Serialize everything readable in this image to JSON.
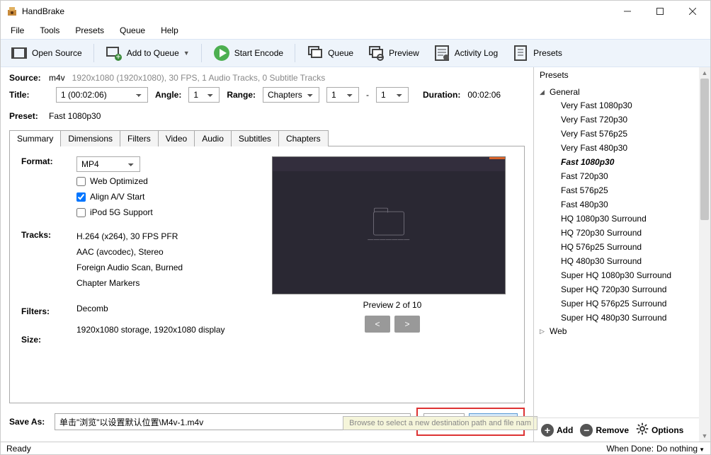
{
  "window": {
    "title": "HandBrake"
  },
  "menubar": [
    "File",
    "Tools",
    "Presets",
    "Queue",
    "Help"
  ],
  "toolbar": [
    {
      "id": "open-source",
      "label": "Open Source"
    },
    {
      "id": "add-queue",
      "label": "Add to Queue",
      "dropdown": true
    },
    {
      "id": "start-encode",
      "label": "Start Encode"
    },
    {
      "id": "queue",
      "label": "Queue"
    },
    {
      "id": "preview",
      "label": "Preview"
    },
    {
      "id": "activity-log",
      "label": "Activity Log"
    },
    {
      "id": "presets",
      "label": "Presets"
    }
  ],
  "labels": {
    "source": "Source:",
    "title": "Title:",
    "angle": "Angle:",
    "range": "Range:",
    "duration": "Duration:",
    "preset": "Preset:",
    "format": "Format:",
    "tracks": "Tracks:",
    "filters": "Filters:",
    "size": "Size:",
    "save_as": "Save As:",
    "browse": "Browse",
    "presets_hdr": "Presets",
    "add": "Add",
    "remove": "Remove",
    "options": "Options",
    "ready": "Ready",
    "when_done": "When Done:"
  },
  "source": {
    "name": "m4v",
    "info": "1920x1080 (1920x1080), 30 FPS, 1 Audio Tracks, 0 Subtitle Tracks"
  },
  "title_select": "1 (00:02:06)",
  "angle": "1",
  "range_mode": "Chapters",
  "range_from": "1",
  "range_dash": "-",
  "range_to": "1",
  "duration": "00:02:06",
  "preset_name": "Fast 1080p30",
  "tabs": [
    "Summary",
    "Dimensions",
    "Filters",
    "Video",
    "Audio",
    "Subtitles",
    "Chapters"
  ],
  "summary": {
    "format": "MP4",
    "checks": {
      "web_optimized": {
        "label": "Web Optimized",
        "checked": false
      },
      "align_av": {
        "label": "Align A/V Start",
        "checked": true
      },
      "ipod": {
        "label": "iPod 5G Support",
        "checked": false
      }
    },
    "tracks": [
      "H.264 (x264), 30 FPS PFR",
      "AAC (avcodec), Stereo",
      "Foreign Audio Scan, Burned",
      "Chapter Markers"
    ],
    "filters_val": "Decomb",
    "size_val": "1920x1080 storage, 1920x1080 display",
    "preview_caption": "Preview 2 of 10",
    "prev": "<",
    "next": ">"
  },
  "save_as": "单击\"浏览\"以设置默认位置\\M4v-1.m4v",
  "tooltip": "Browse to select a new destination path and file nam",
  "presets": {
    "groups": [
      {
        "name": "General",
        "expanded": true,
        "items": [
          "Very Fast 1080p30",
          "Very Fast 720p30",
          "Very Fast 576p25",
          "Very Fast 480p30",
          "Fast 1080p30",
          "Fast 720p30",
          "Fast 576p25",
          "Fast 480p30",
          "HQ 1080p30 Surround",
          "HQ 720p30 Surround",
          "HQ 576p25 Surround",
          "HQ 480p30 Surround",
          "Super HQ 1080p30 Surround",
          "Super HQ 720p30 Surround",
          "Super HQ 576p25 Surround",
          "Super HQ 480p30 Surround"
        ],
        "selected": "Fast 1080p30"
      },
      {
        "name": "Web",
        "expanded": false,
        "items": []
      }
    ]
  },
  "when_done_value": "Do nothing"
}
